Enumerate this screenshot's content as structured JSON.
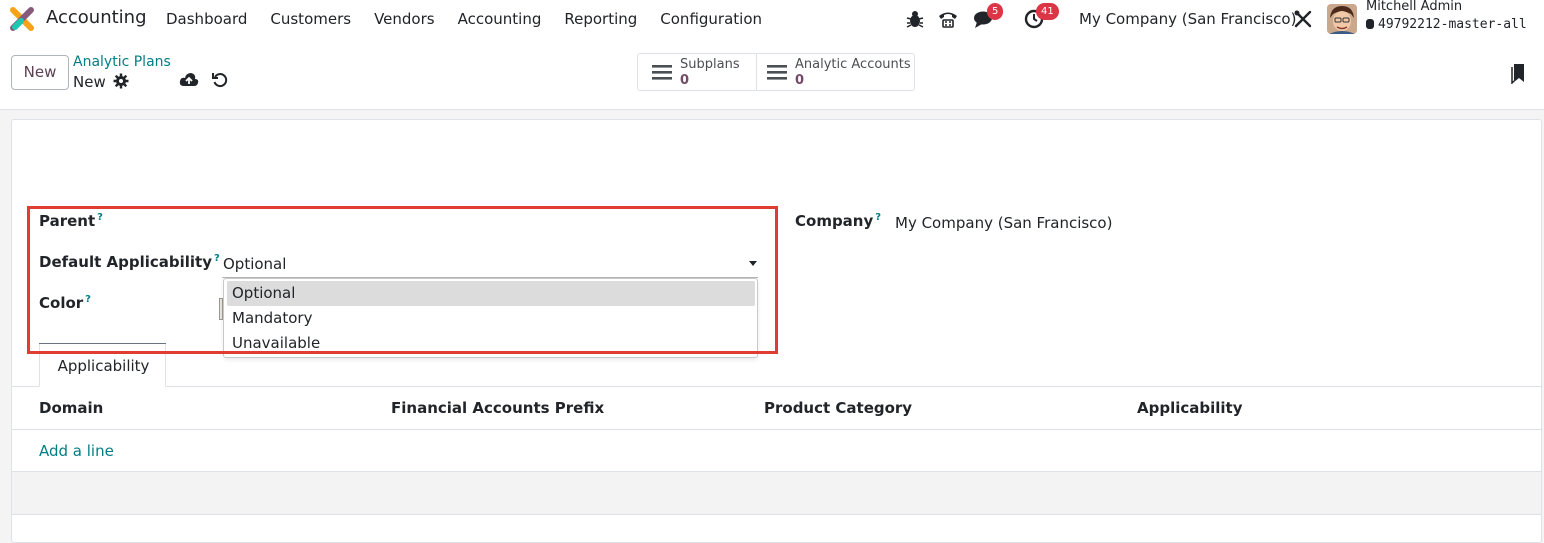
{
  "navbar": {
    "app_name": "Accounting",
    "menu": [
      "Dashboard",
      "Customers",
      "Vendors",
      "Accounting",
      "Reporting",
      "Configuration"
    ],
    "messages_badge": "5",
    "activities_badge": "41",
    "company": "My Company (San Francisco)",
    "user_name": "Mitchell Admin",
    "database": "49792212-master-all"
  },
  "control_panel": {
    "new_label": "New",
    "breadcrumb": "Analytic Plans",
    "record_name": "New",
    "stats": [
      {
        "label": "Subplans",
        "value": "0"
      },
      {
        "label": "Analytic Accounts",
        "value": "0"
      }
    ]
  },
  "form": {
    "parent_label": "Parent",
    "default_applicability_label": "Default Applicability",
    "default_applicability_value": "Optional",
    "color_label": "Color",
    "company_label": "Company",
    "company_value": "My Company (San Francisco)",
    "help_mark": "?",
    "applicability_options": [
      "Optional",
      "Mandatory",
      "Unavailable"
    ]
  },
  "tabs": {
    "active": "Applicability"
  },
  "list": {
    "columns": [
      "Domain",
      "Financial Accounts Prefix",
      "Product Category",
      "Applicability"
    ],
    "add_line": "Add a line"
  },
  "colors": {
    "brand": "#714b67",
    "link": "#017e84",
    "badge": "#dc3545",
    "highlight": "#e03c31"
  }
}
